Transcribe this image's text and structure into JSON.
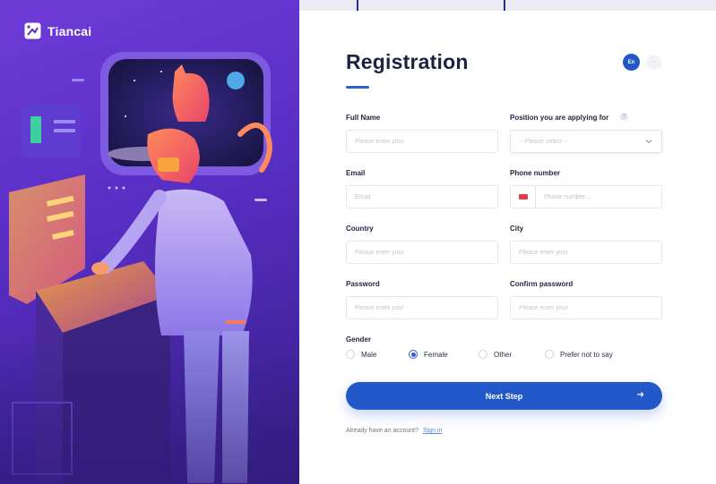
{
  "brand": {
    "name": "Tiancai"
  },
  "form": {
    "title": "Registration",
    "language": {
      "active": "En"
    },
    "fields": {
      "full_name": {
        "label": "Full Name",
        "placeholder": "Please enter your"
      },
      "position": {
        "label": "Position you are applying for",
        "value": "-- Please select --"
      },
      "email": {
        "label": "Email",
        "placeholder": "Email"
      },
      "phone": {
        "label": "Phone number",
        "placeholder": "Phone number ..."
      },
      "country": {
        "label": "Country",
        "placeholder": "Please enter your"
      },
      "city": {
        "label": "City",
        "placeholder": "Please enter your"
      },
      "password": {
        "label": "Password",
        "placeholder": "Please enter your"
      },
      "confirm_password": {
        "label": "Confirm password",
        "placeholder": "Please enter your"
      }
    },
    "gender": {
      "label": "Gender",
      "options": [
        "Male",
        "Female",
        "Other",
        "Prefer not to say"
      ],
      "selected": "Female"
    },
    "next_button": "Next Step",
    "footer": {
      "text": "Already have an account?",
      "link": "Sign in"
    }
  },
  "colors": {
    "accent": "#2358c9",
    "panel": "#5a2fc7",
    "title": "#1b2242"
  }
}
